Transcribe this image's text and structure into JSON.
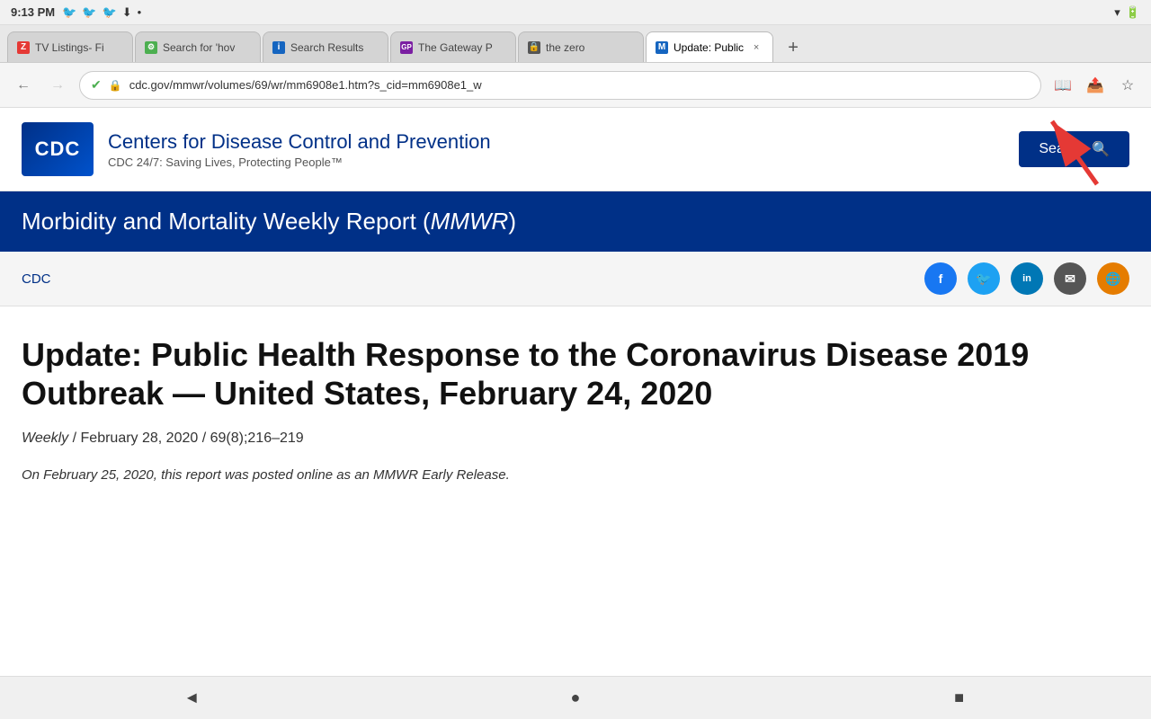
{
  "statusBar": {
    "time": "9:13 PM",
    "twitterIcons": "🐦🐦🐦",
    "wifiIcon": "wifi",
    "batteryIcon": "battery"
  },
  "tabs": [
    {
      "id": "tab1",
      "favicon_color": "#e53935",
      "favicon_letter": "Z",
      "label": "TV Listings- Fi",
      "active": false
    },
    {
      "id": "tab2",
      "favicon_color": "#4caf50",
      "favicon_letter": "⚙",
      "label": "Search for 'hov",
      "active": false
    },
    {
      "id": "tab3",
      "favicon_color": "#1565c0",
      "favicon_letter": "i",
      "label": "Search Results",
      "active": false
    },
    {
      "id": "tab4",
      "favicon_color": "#7b1fa2",
      "favicon_letter": "GP",
      "label": "The Gateway P",
      "active": false
    },
    {
      "id": "tab5",
      "favicon_color": "#555",
      "favicon_letter": "🔒",
      "label": "the zero",
      "active": false
    },
    {
      "id": "tab6",
      "favicon_color": "#1565c0",
      "favicon_letter": "M",
      "label": "Update: Public",
      "active": true,
      "closable": true
    }
  ],
  "addressBar": {
    "url": "cdc.gov/mmwr/volumes/69/wr/mm6908e1.htm?s_cid=mm6908e1_w",
    "backDisabled": false,
    "forwardDisabled": true
  },
  "cdcHeader": {
    "logoText": "CDC",
    "fullName": "Centers for Disease Control and Prevention",
    "tagline": "CDC 24/7: Saving Lives, Protecting People™",
    "searchButtonLabel": "Search"
  },
  "mmwrBanner": {
    "title": "Morbidity and Mortality Weekly Report (",
    "titleItalic": "MMWR",
    "titleClose": ")"
  },
  "breadcrumb": {
    "linkText": "CDC"
  },
  "socialIcons": [
    {
      "name": "facebook",
      "color": "#1877f2",
      "letter": "f"
    },
    {
      "name": "twitter",
      "color": "#1da1f2",
      "letter": "🐦"
    },
    {
      "name": "linkedin",
      "color": "#0077b5",
      "letter": "in"
    },
    {
      "name": "email",
      "color": "#555",
      "letter": "✉"
    },
    {
      "name": "rss",
      "color": "#e57c00",
      "letter": "🌐"
    }
  ],
  "article": {
    "title": "Update: Public Health Response to the Coronavirus Disease 2019 Outbreak — United States, February 24, 2020",
    "metaWeekly": "Weekly",
    "metaDate": "/ February 28, 2020 / 69(8);216–219",
    "excerpt": "On February 25, 2020, this report was posted online as an MMWR Early Release."
  },
  "bottomNav": {
    "backLabel": "◄",
    "homeLabel": "●",
    "recentLabel": "■"
  }
}
